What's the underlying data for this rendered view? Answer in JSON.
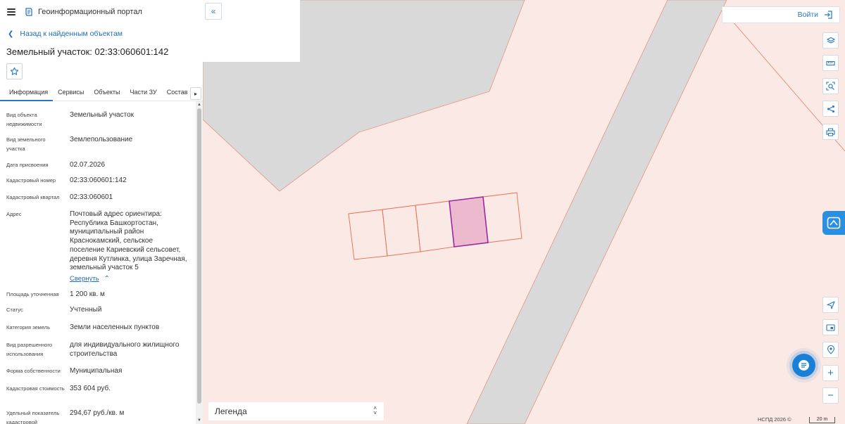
{
  "app": {
    "title": "Геоинформационный портал"
  },
  "nav": {
    "back_label": "Назад к найденным объектам"
  },
  "object": {
    "title": "Земельный участок: 02:33:060601:142"
  },
  "tabs": [
    {
      "label": "Информация",
      "active": true
    },
    {
      "label": "Сервисы"
    },
    {
      "label": "Объекты"
    },
    {
      "label": "Части ЗУ"
    },
    {
      "label": "Состав"
    }
  ],
  "properties": [
    {
      "label": "Вид объекта недвижимости",
      "value": "Земельный участок"
    },
    {
      "label": "Вид земельного участка",
      "value": "Землепользование"
    },
    {
      "label": "Дата присвоения",
      "value": "02.07.2026"
    },
    {
      "label": "Кадастровый номер",
      "value": "02:33:060601:142"
    },
    {
      "label": "Кадастровый квартал",
      "value": "02:33:060601"
    },
    {
      "label": "Адрес",
      "value": "Почтовый адрес ориентира: Республика Башкортостан, муниципальный район Краснокамский, сельское поселение Кариевский сельсовет, деревня Кутлинка, улица Заречная, земельный участок 5"
    },
    {
      "label": "Площадь уточненная",
      "value": "1 200 кв. м"
    },
    {
      "label": "Статус",
      "value": "Учтенный"
    },
    {
      "label": "Категория земель",
      "value": "Земли населенных пунктов"
    },
    {
      "label": "Вид разрешенного использования",
      "value": "для индивидуального жилищного строительства"
    },
    {
      "label": "Форма собственности",
      "value": "Муниципальная"
    },
    {
      "label": "Кадастровая стоимость",
      "value": "353 604 руб."
    },
    {
      "label": "Удельный показатель кадастровой",
      "value": "294,67 руб./кв. м"
    }
  ],
  "address_collapse_label": "Свернуть",
  "header": {
    "login_label": "Войти"
  },
  "legend": {
    "label": "Легенда"
  },
  "footer": {
    "copyright": "НСПД 2026 ©",
    "scale": "20 m"
  },
  "colors": {
    "accent": "#2b78c2",
    "map_background": "#fbe9e5",
    "road": "#d9d9d9",
    "parcel_outline": "#e0704f",
    "selected_parcel_fill": "#ecb9cf",
    "selected_parcel_stroke": "#9a2aa0"
  },
  "icons": [
    "menu-icon",
    "logo-icon",
    "chevron-left-icon",
    "star-icon",
    "double-chevron-left-icon",
    "login-icon",
    "layers-icon",
    "ruler-icon",
    "area-search-icon",
    "share-icon",
    "print-icon",
    "widget-icon",
    "chat-icon",
    "locate-icon",
    "map-view-icon",
    "geolocation-icon",
    "zoom-in-icon",
    "zoom-out-icon"
  ]
}
